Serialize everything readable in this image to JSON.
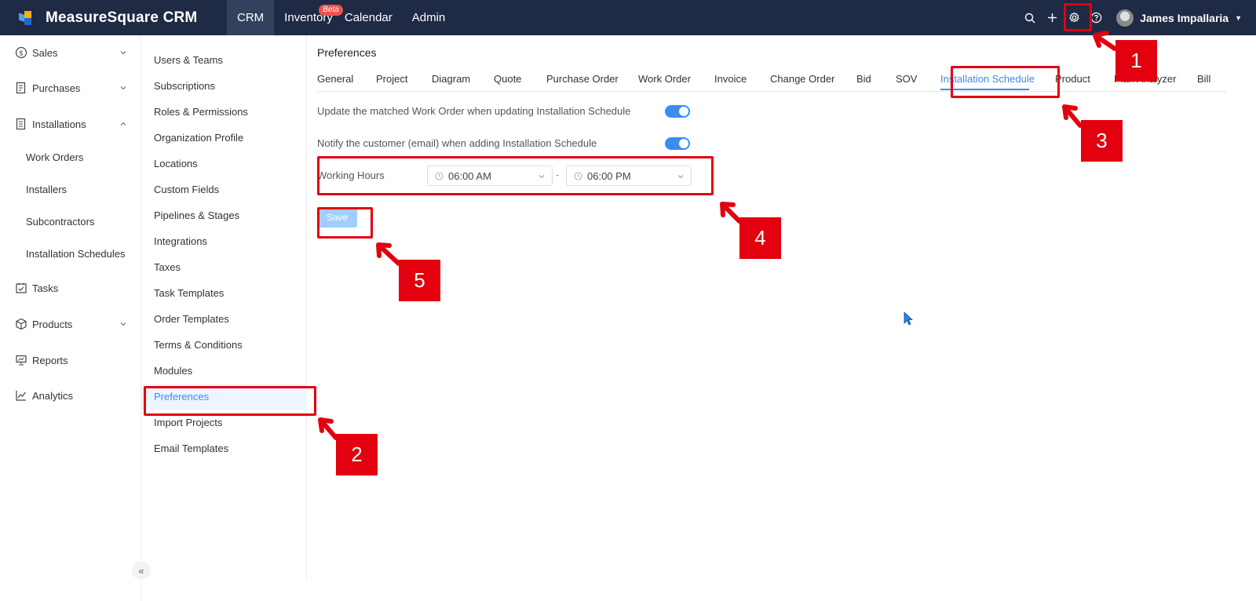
{
  "app": {
    "brand": "MeasureSquare CRM",
    "brand_colors": [
      "#4aa3f0",
      "#f5b400",
      "#2a62c9"
    ]
  },
  "topnav": {
    "items": [
      {
        "label": "CRM",
        "active": true
      },
      {
        "label": "Inventory",
        "badge": "Beta"
      },
      {
        "label": "Calendar"
      },
      {
        "label": "Admin"
      }
    ],
    "icons": [
      "search-icon",
      "plus-icon",
      "gear-icon",
      "help-icon"
    ],
    "user_name": "James Impallaria"
  },
  "sidebar": {
    "sales": "Sales",
    "purchases": "Purchases",
    "installations": "Installations",
    "installations_children": [
      "Work Orders",
      "Installers",
      "Subcontractors",
      "Installation Schedules"
    ],
    "tasks": "Tasks",
    "products": "Products",
    "reports": "Reports",
    "analytics": "Analytics",
    "collapse_glyph": "«"
  },
  "settings_nav": {
    "items": [
      "Users & Teams",
      "Subscriptions",
      "Roles & Permissions",
      "Organization Profile",
      "Locations",
      "Custom Fields",
      "Pipelines & Stages",
      "Integrations",
      "Taxes",
      "Task Templates",
      "Order Templates",
      "Terms & Conditions",
      "Modules",
      "Preferences",
      "Import Projects",
      "Email Templates"
    ],
    "active": "Preferences"
  },
  "main": {
    "title": "Preferences",
    "tabs": [
      "General",
      "Project",
      "Diagram",
      "Quote",
      "Purchase Order",
      "Work Order",
      "Invoice",
      "Change Order",
      "Bid",
      "SOV",
      "Installation Schedule",
      "Product",
      "Plan Analyzer",
      "Bill"
    ],
    "active_tab": "Installation Schedule",
    "settings": {
      "update_work_order_label": "Update the matched Work Order when updating Installation Schedule",
      "update_work_order_on": true,
      "notify_customer_label": "Notify the customer (email) when adding Installation Schedule",
      "notify_customer_on": true,
      "working_hours_label": "Working Hours",
      "start_time": "06:00 AM",
      "separator": "-",
      "end_time": "06:00 PM"
    },
    "save_label": "Save"
  },
  "annotations": {
    "n1": "1",
    "n2": "2",
    "n3": "3",
    "n4": "4",
    "n5": "5",
    "color": "#e3000f"
  }
}
